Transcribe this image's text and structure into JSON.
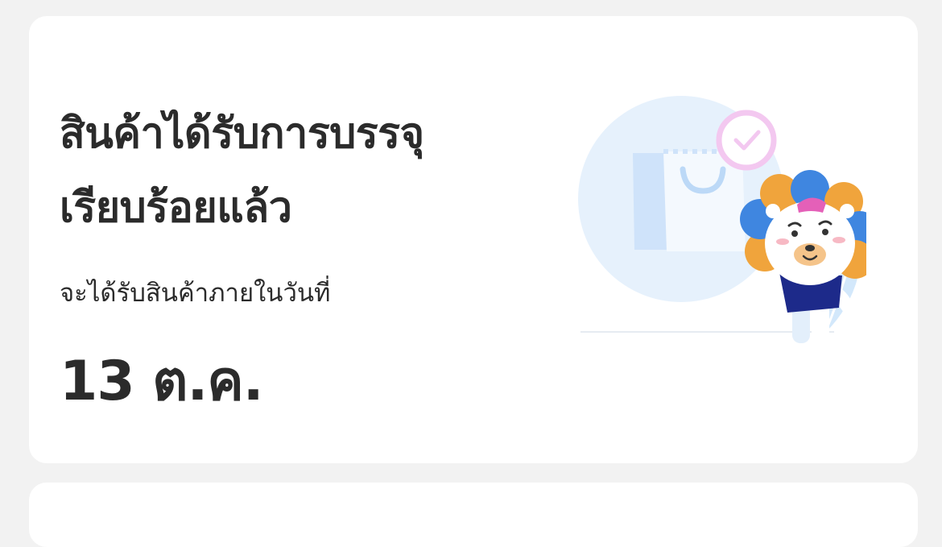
{
  "status_card": {
    "title_line1": "สินค้าได้รับการบรรจุ",
    "title_line2": "เรียบร้อยแล้ว",
    "delivery_label": "จะได้รับสินค้าภายในวันที่",
    "delivery_date": "13 ต.ค.",
    "illustration": "mascot-packed-bag-illustration"
  },
  "colors": {
    "background": "#f2f2f2",
    "card": "#ffffff",
    "text": "#2b2b2b",
    "circle_bg": "#e4f0fc",
    "check_ring": "#f3c8f0",
    "mane_orange": "#f0a43c",
    "mane_blue": "#3f86e0",
    "shirt_navy": "#1d2a8a",
    "cap_pink": "#e460b8"
  }
}
